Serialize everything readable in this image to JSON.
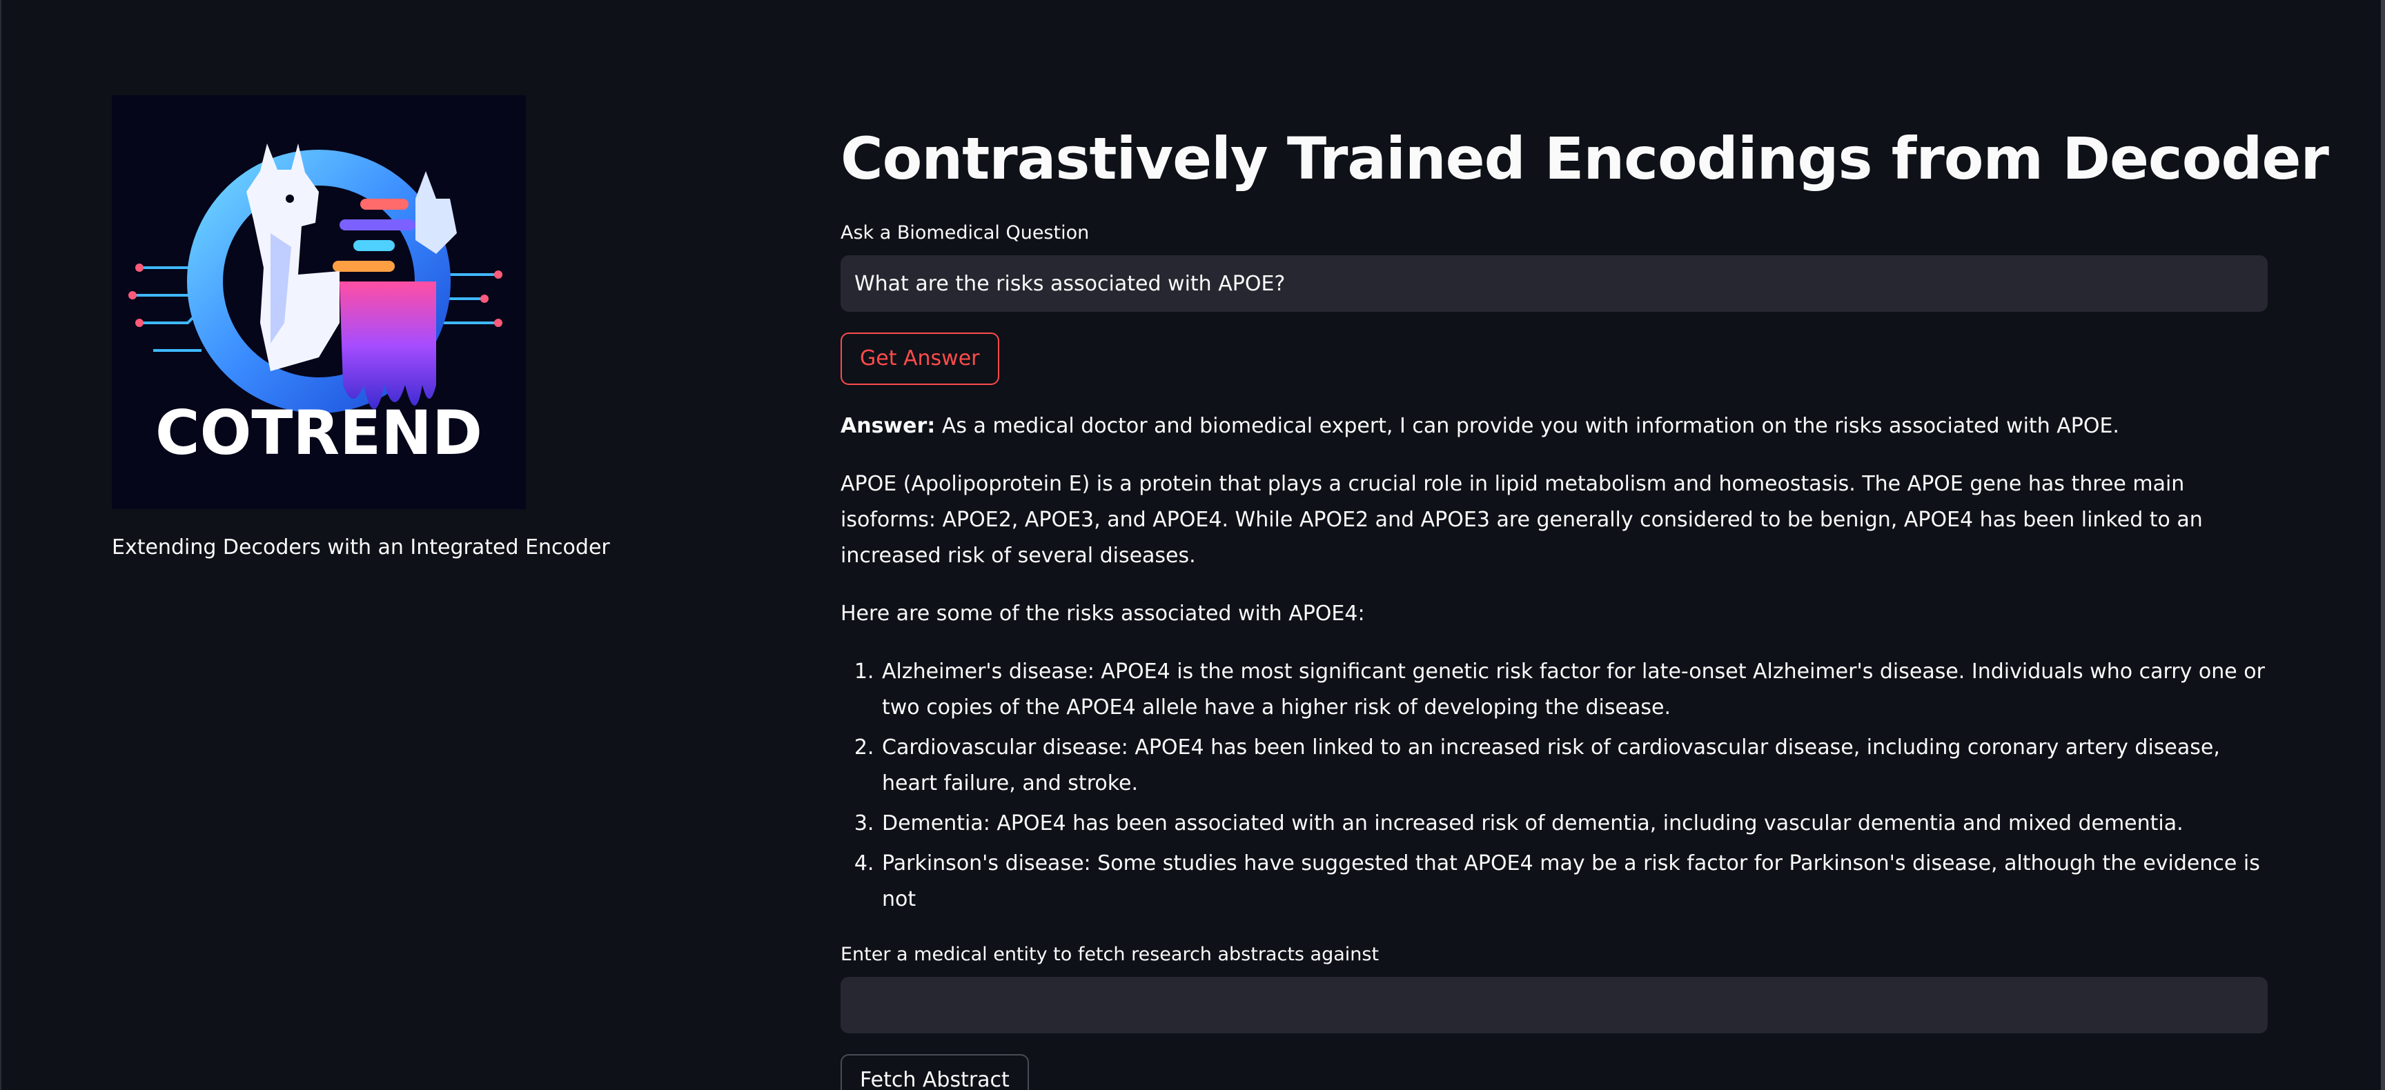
{
  "sidebar": {
    "logo_text": "COTREND",
    "tagline": "Extending Decoders with an Integrated Encoder"
  },
  "main": {
    "title": "Contrastively Trained Encodings from Decoder",
    "question": {
      "label": "Ask a Biomedical Question",
      "value": "What are the risks associated with APOE?"
    },
    "get_answer_label": "Get Answer",
    "answer": {
      "prefix": "Answer:",
      "intro": "As a medical doctor and biomedical expert, I can provide you with information on the risks associated with APOE.",
      "paragraph": "APOE (Apolipoprotein E) is a protein that plays a crucial role in lipid metabolism and homeostasis. The APOE gene has three main isoforms: APOE2, APOE3, and APOE4. While APOE2 and APOE3 are generally considered to be benign, APOE4 has been linked to an increased risk of several diseases.",
      "list_intro": "Here are some of the risks associated with APOE4:",
      "items": [
        "Alzheimer's disease: APOE4 is the most significant genetic risk factor for late-onset Alzheimer's disease. Individuals who carry one or two copies of the APOE4 allele have a higher risk of developing the disease.",
        "Cardiovascular disease: APOE4 has been linked to an increased risk of cardiovascular disease, including coronary artery disease, heart failure, and stroke.",
        "Dementia: APOE4 has been associated with an increased risk of dementia, including vascular dementia and mixed dementia.",
        "Parkinson's disease: Some studies have suggested that APOE4 may be a risk factor for Parkinson's disease, although the evidence is not"
      ]
    },
    "entity": {
      "label": "Enter a medical entity to fetch research abstracts against",
      "value": ""
    },
    "fetch_label": "Fetch Abstract"
  },
  "colors": {
    "background": "#0e1117",
    "input_bg": "#262730",
    "accent": "#ff4b4b",
    "text": "#fafafa"
  }
}
